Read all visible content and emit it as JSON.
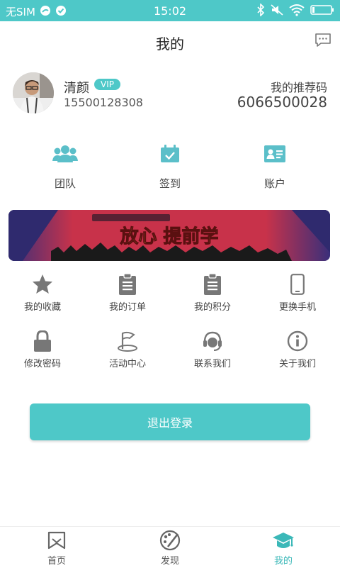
{
  "status_bar": {
    "carrier": "无SIM",
    "time": "15:02"
  },
  "header": {
    "title": "我的",
    "message_icon": "message-icon"
  },
  "profile": {
    "name": "清颜",
    "badge": "VIP",
    "phone": "15500128308",
    "referral_label": "我的推荐码",
    "referral_code": "6066500028"
  },
  "quick_actions": [
    {
      "label": "团队",
      "icon": "team-icon"
    },
    {
      "label": "签到",
      "icon": "checkin-calendar-icon"
    },
    {
      "label": "账户",
      "icon": "account-card-icon"
    }
  ],
  "banner": {
    "headline": "放心 提前学"
  },
  "menu": [
    {
      "label": "我的收藏",
      "icon": "star-icon"
    },
    {
      "label": "我的订单",
      "icon": "clipboard-icon"
    },
    {
      "label": "我的积分",
      "icon": "clipboard-icon"
    },
    {
      "label": "更换手机",
      "icon": "phone-icon"
    },
    {
      "label": "修改密码",
      "icon": "lock-icon"
    },
    {
      "label": "活动中心",
      "icon": "flag-icon"
    },
    {
      "label": "联系我们",
      "icon": "headset-icon"
    },
    {
      "label": "关于我们",
      "icon": "info-icon"
    }
  ],
  "logout_label": "退出登录",
  "tabs": [
    {
      "label": "首页",
      "icon": "home-bookmark-icon"
    },
    {
      "label": "发现",
      "icon": "discover-palette-icon"
    },
    {
      "label": "我的",
      "icon": "graduation-cap-icon",
      "active": true
    }
  ],
  "colors": {
    "accent": "#4ec8c8",
    "icon_teal": "#5bbfc9",
    "icon_gray": "#777777"
  }
}
